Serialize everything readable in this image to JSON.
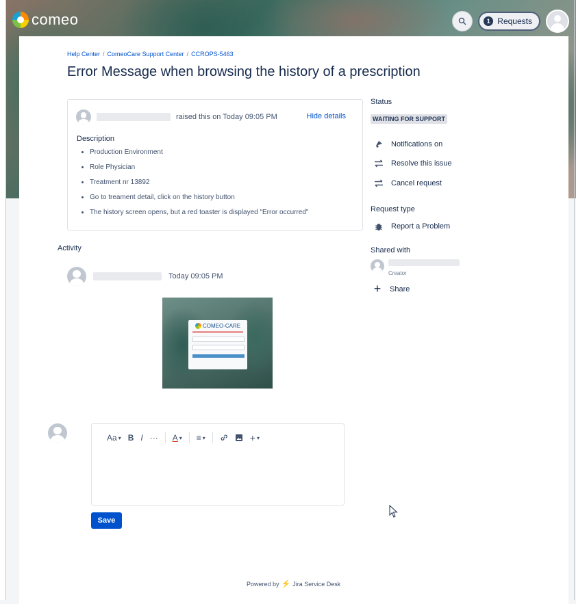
{
  "header": {
    "brand": "comeo",
    "requests_label": "Requests",
    "requests_count": "1"
  },
  "breadcrumb": {
    "items": [
      "Help Center",
      "ComeoCare Support Center",
      "CCROPS-5463"
    ],
    "separator": "/"
  },
  "issue": {
    "title": "Error Message when browsing the history of a prescription",
    "raised_text": "raised this on Today 09:05 PM",
    "hide_details": "Hide details",
    "description_heading": "Description",
    "description_items": [
      "Production Environment",
      "Role Physician",
      "Treatment nr 13892",
      "Go to treament detail, click on the history button",
      "The history screen opens, but a red toaster is displayed \"Error occurred\""
    ]
  },
  "activity": {
    "heading": "Activity",
    "time": "Today 09:05 PM",
    "attachment": {
      "logo_text": "COMEO-CARE"
    }
  },
  "editor": {
    "toolbar": {
      "text_style": "Aa",
      "bold": "B",
      "italic": "I",
      "more": "···",
      "color": "A",
      "list": "≡",
      "link": "🔗",
      "image": "▣",
      "insert": "+"
    },
    "save_label": "Save"
  },
  "sidebar": {
    "status_heading": "Status",
    "status_value": "WAITING FOR SUPPORT",
    "actions": [
      {
        "label": "Notifications on",
        "icon": "bell-icon"
      },
      {
        "label": "Resolve this issue",
        "icon": "transition-icon"
      },
      {
        "label": "Cancel request",
        "icon": "transition-icon"
      }
    ],
    "request_type_heading": "Request type",
    "request_type_value": "Report a Problem",
    "shared_with_heading": "Shared with",
    "shared_role": "Creator",
    "share_label": "Share"
  },
  "footer": {
    "powered_by": "Powered by",
    "product": "Jira Service Desk"
  },
  "colors": {
    "link": "#0052cc",
    "primary_button": "#0052cc",
    "text": "#172b4d",
    "lozenge_bg": "#dfe1e6"
  }
}
